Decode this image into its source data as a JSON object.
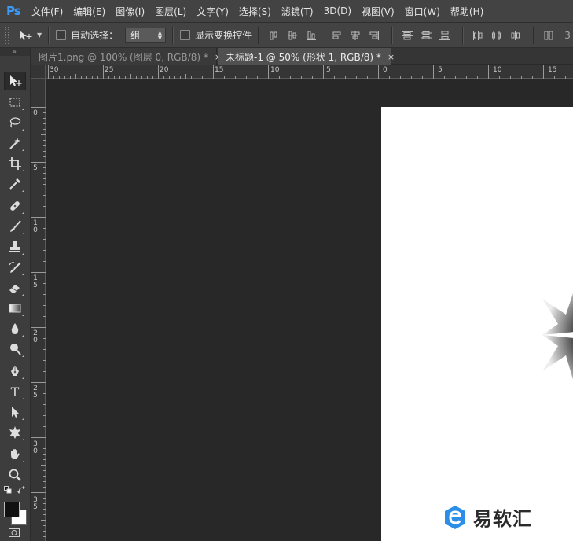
{
  "app": {
    "logo_text": "Ps",
    "accent": "#3c9af7"
  },
  "menu": [
    {
      "label": "文件(F)"
    },
    {
      "label": "编辑(E)"
    },
    {
      "label": "图像(I)"
    },
    {
      "label": "图层(L)"
    },
    {
      "label": "文字(Y)"
    },
    {
      "label": "选择(S)"
    },
    {
      "label": "滤镜(T)"
    },
    {
      "label": "3D(D)"
    },
    {
      "label": "视图(V)"
    },
    {
      "label": "窗口(W)"
    },
    {
      "label": "帮助(H)"
    }
  ],
  "options": {
    "auto_select_label": "自动选择：",
    "auto_select_value": "组",
    "show_transform_label": "显示变换控件",
    "trailing_text": "3"
  },
  "tabs": [
    {
      "label": "图片1.png @ 100% (图层 0, RGB/8) *",
      "close": "×"
    },
    {
      "label": "未标题-1 @ 50% (形状 1, RGB/8) *",
      "close": "×"
    }
  ],
  "ruler_h_labels": [
    "30",
    "25",
    "20",
    "15",
    "10",
    "5",
    "0",
    "5",
    "10",
    "15"
  ],
  "ruler_v_labels": [
    "0",
    "5",
    "10",
    "15",
    "20",
    "25",
    "30",
    "35"
  ],
  "tools": [
    {
      "name": "move-tool",
      "icon": "move-icon"
    },
    {
      "name": "marquee-tool",
      "icon": "marquee-icon"
    },
    {
      "name": "lasso-tool",
      "icon": "lasso-icon"
    },
    {
      "name": "magic-wand-tool",
      "icon": "magic-wand-icon"
    },
    {
      "name": "crop-tool",
      "icon": "crop-icon"
    },
    {
      "name": "eyedropper-tool",
      "icon": "eyedropper-icon"
    },
    {
      "name": "healing-tool",
      "icon": "bandage-icon"
    },
    {
      "name": "brush-tool",
      "icon": "brush-icon"
    },
    {
      "name": "stamp-tool",
      "icon": "stamp-icon"
    },
    {
      "name": "history-brush-tool",
      "icon": "history-brush-icon"
    },
    {
      "name": "eraser-tool",
      "icon": "eraser-icon"
    },
    {
      "name": "gradient-tool",
      "icon": "gradient-icon"
    },
    {
      "name": "blur-tool",
      "icon": "drop-icon"
    },
    {
      "name": "dodge-tool",
      "icon": "dodge-icon"
    },
    {
      "name": "pen-tool",
      "icon": "pen-icon"
    },
    {
      "name": "type-tool",
      "icon": "type-icon",
      "text": "T"
    },
    {
      "name": "path-select-tool",
      "icon": "arrow-icon"
    },
    {
      "name": "shape-tool",
      "icon": "shape-icon"
    },
    {
      "name": "hand-tool",
      "icon": "hand-icon"
    },
    {
      "name": "zoom-tool",
      "icon": "zoom-icon"
    }
  ],
  "watermark": {
    "text": "易软汇"
  }
}
